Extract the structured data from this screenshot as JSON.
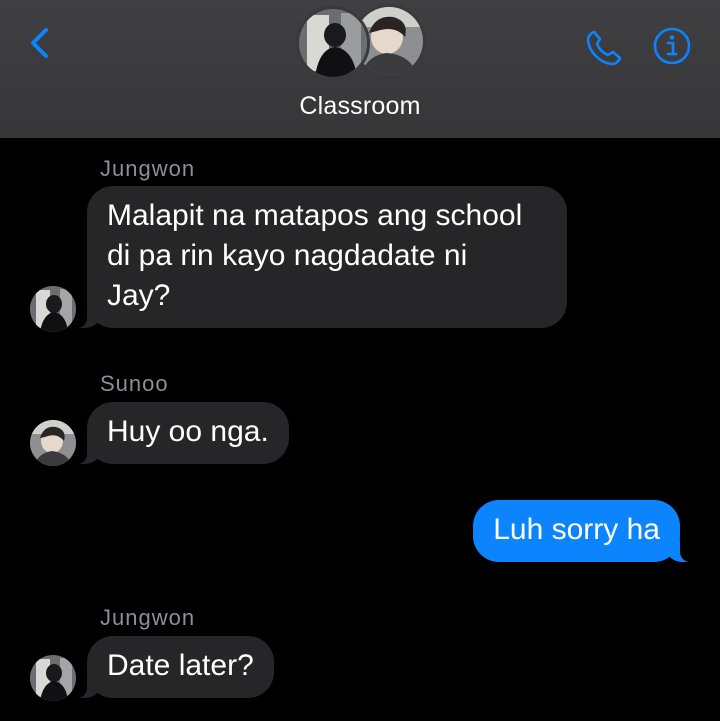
{
  "header": {
    "title": "Classroom",
    "back_icon": "chevron-left-icon",
    "call_icon": "phone-icon",
    "info_icon": "info-icon",
    "accent_color": "#0b84fe"
  },
  "messages": [
    {
      "sender": "Jungwon",
      "direction": "incoming",
      "lines": [
        "Malapit na matapos ang school",
        "di pa rin kayo nagdadate ni",
        "Jay?"
      ]
    },
    {
      "sender": "Sunoo",
      "direction": "incoming",
      "lines": [
        "Huy oo nga."
      ]
    },
    {
      "sender": "",
      "direction": "outgoing",
      "lines": [
        "Luh sorry ha"
      ]
    },
    {
      "sender": "Jungwon",
      "direction": "incoming",
      "lines": [
        "Date later?"
      ]
    }
  ]
}
